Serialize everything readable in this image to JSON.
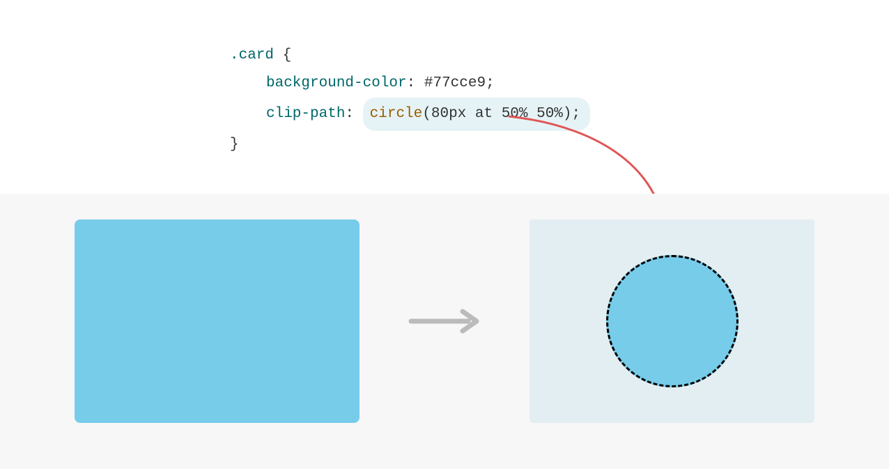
{
  "code": {
    "selector": ".card",
    "open_brace": " {",
    "close_brace": "}",
    "line1": {
      "property": "background-color",
      "value": "#77cce9"
    },
    "line2": {
      "property": "clip-path",
      "func_name": "circle",
      "func_args": "80px at 50% 50%"
    }
  },
  "colors": {
    "card_bg": "#77cce9",
    "highlight_bg": "#e6f3f6",
    "demo_bg": "#f7f7f7",
    "result_bg": "#e3eef3",
    "connector": "#e05555",
    "arrow_gray": "#bbbbbb"
  }
}
